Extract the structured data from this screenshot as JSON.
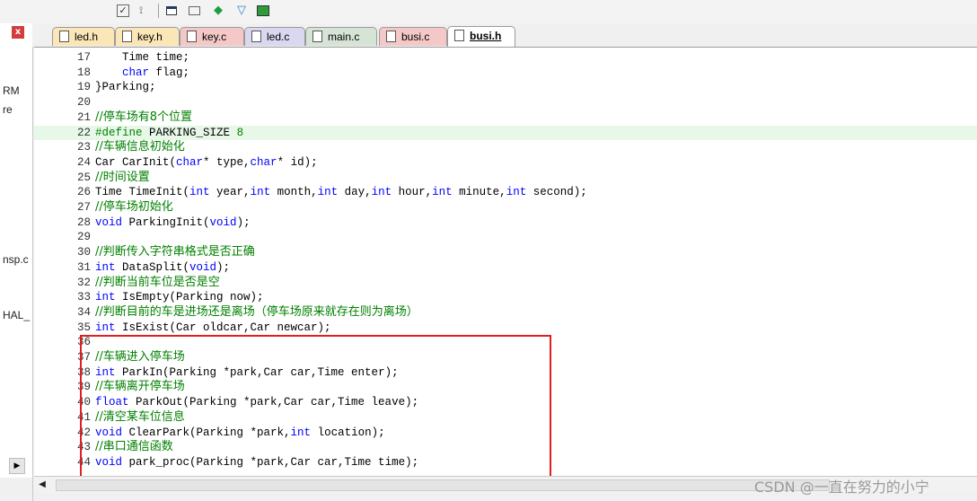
{
  "toolbar": {
    "icons": [
      "checkbox-icon",
      "magnet-icon",
      "window-icon",
      "layers-icon",
      "gem-icon",
      "filter-icon",
      "grid-icon"
    ]
  },
  "left_panel": {
    "lines": [
      "RM",
      "re",
      "nsp.c",
      "HAL_"
    ],
    "close_glyph": "x",
    "scroll_glyph": "▶"
  },
  "tabs": [
    {
      "label": "led.h",
      "color": "#fbe6b8"
    },
    {
      "label": "key.h",
      "color": "#fbe6b8"
    },
    {
      "label": "key.c",
      "color": "#f5c8c8"
    },
    {
      "label": "led.c",
      "color": "#dad8f0"
    },
    {
      "label": "main.c",
      "color": "#d6e4d6"
    },
    {
      "label": "busi.c",
      "color": "#f5c8c8"
    },
    {
      "label": "busi.h",
      "color": "#ffffff",
      "active": true
    }
  ],
  "code_lines": [
    {
      "n": "17",
      "text": "    Time time;",
      "kind": "code"
    },
    {
      "n": "18",
      "text": "    char flag;",
      "kind": "code"
    },
    {
      "n": "19",
      "text": "}Parking;",
      "kind": "code"
    },
    {
      "n": "20",
      "text": "",
      "kind": "code"
    },
    {
      "n": "21",
      "text": "//停车场有8个位置",
      "kind": "comment"
    },
    {
      "n": "22",
      "text": "#define PARKING_SIZE 8",
      "kind": "pp",
      "highlight": true
    },
    {
      "n": "23",
      "text": "//车辆信息初始化",
      "kind": "comment"
    },
    {
      "n": "24",
      "text": "Car CarInit(char* type,char* id);",
      "kind": "code"
    },
    {
      "n": "25",
      "text": "//时间设置",
      "kind": "comment"
    },
    {
      "n": "26",
      "text": "Time TimeInit(int year,int month,int day,int hour,int minute,int second);",
      "kind": "code"
    },
    {
      "n": "27",
      "text": "//停车场初始化",
      "kind": "comment"
    },
    {
      "n": "28",
      "text": "void ParkingInit(void);",
      "kind": "code"
    },
    {
      "n": "29",
      "text": "",
      "kind": "code"
    },
    {
      "n": "30",
      "text": "//判断传入字符串格式是否正确",
      "kind": "comment"
    },
    {
      "n": "31",
      "text": "int DataSplit(void);",
      "kind": "code"
    },
    {
      "n": "32",
      "text": "//判断当前车位是否是空",
      "kind": "comment"
    },
    {
      "n": "33",
      "text": "int IsEmpty(Parking now);",
      "kind": "code"
    },
    {
      "n": "34",
      "text": "//判断目前的车是进场还是离场（停车场原来就存在则为离场）",
      "kind": "comment"
    },
    {
      "n": "35",
      "text": "int IsExist(Car oldcar,Car newcar);",
      "kind": "code"
    },
    {
      "n": "36",
      "text": "",
      "kind": "code"
    },
    {
      "n": "37",
      "text": "//车辆进入停车场",
      "kind": "comment"
    },
    {
      "n": "38",
      "text": "int ParkIn(Parking *park,Car car,Time enter);",
      "kind": "code"
    },
    {
      "n": "39",
      "text": "//车辆离开停车场",
      "kind": "comment"
    },
    {
      "n": "40",
      "text": "float ParkOut(Parking *park,Car car,Time leave);",
      "kind": "code"
    },
    {
      "n": "41",
      "text": "//清空某车位信息",
      "kind": "comment"
    },
    {
      "n": "42",
      "text": "void ClearPark(Parking *park,int location);",
      "kind": "code"
    },
    {
      "n": "43",
      "text": "//串口通信函数",
      "kind": "comment"
    },
    {
      "n": "44",
      "text": "void park_proc(Parking *park,Car car,Time time);",
      "kind": "code"
    }
  ],
  "colors": {
    "keyword": "#0000ff",
    "comment": "#008000",
    "highlight_box": "#e02020"
  },
  "keywords": [
    "int",
    "char",
    "void",
    "float"
  ],
  "hscroll": {
    "left_glyph": "◀"
  },
  "watermark": "CSDN @一直在努力的小宁"
}
